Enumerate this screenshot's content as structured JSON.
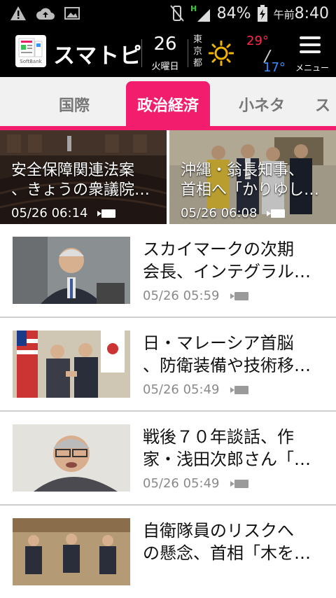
{
  "status_bar": {
    "battery_percent": "84%",
    "clock_prefix": "午前",
    "clock_time": "8:40"
  },
  "header": {
    "app_name": "スマトピ",
    "logo_caption": "SoftBank",
    "date_number": "26",
    "weekday": "火曜日",
    "city_chars": [
      "東",
      "京",
      "都"
    ],
    "temp_high": "29°",
    "temp_low": "17°",
    "menu_label": "メニュー",
    "accent_color": "#f21d6d"
  },
  "tabs": [
    {
      "label": "国際"
    },
    {
      "label": "政治経済",
      "active": true
    },
    {
      "label": "小ネタ"
    },
    {
      "label": "ス"
    }
  ],
  "featured": [
    {
      "title": "安全保障関連法案",
      "title_line2": "、きょうの衆議院…",
      "time": "05/26 06:14",
      "icon": "video-camera-icon"
    },
    {
      "title": "沖縄・翁長知事、",
      "title_line2": "首相へ「かりゆし…",
      "time": "05/26 06:08",
      "icon": "video-camera-icon"
    }
  ],
  "articles": [
    {
      "line1": "スカイマークの次期",
      "line2": "会長、インテグラル…",
      "time": "05/26 05:59",
      "icon": "video-camera-icon"
    },
    {
      "line1": "日・マレーシア首脳",
      "line2": "、防衛装備や技術移…",
      "time": "05/26 05:49",
      "icon": "video-camera-icon"
    },
    {
      "line1": "戦後７０年談話、作",
      "line2": "家・浅田次郎さん「…",
      "time": "05/26 05:49",
      "icon": "video-camera-icon"
    },
    {
      "line1": "自衛隊員のリスクへ",
      "line2": "の懸念、首相「木を…",
      "time": "",
      "icon": ""
    }
  ]
}
